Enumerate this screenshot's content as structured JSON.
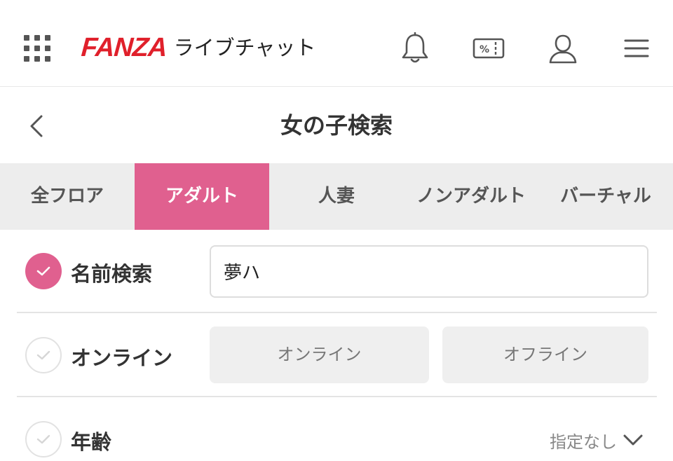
{
  "header": {
    "brand": "FANZA",
    "service": "ライブチャット",
    "icons": [
      "apps-grid-icon",
      "bell-icon",
      "coupon-icon",
      "user-icon",
      "hamburger-menu-icon"
    ],
    "coupon_symbol": "%"
  },
  "titlebar": {
    "title": "女の子検索"
  },
  "tabs": [
    {
      "label": "全フロア",
      "active": false
    },
    {
      "label": "アダルト",
      "active": true
    },
    {
      "label": "人妻",
      "active": false
    },
    {
      "label": "ノンアダルト",
      "active": false
    },
    {
      "label": "バーチャル",
      "active": false
    }
  ],
  "filters": {
    "name_search": {
      "label": "名前検索",
      "checked": true,
      "value": "夢ハ"
    },
    "online": {
      "label": "オンライン",
      "checked": false,
      "options": [
        "オンライン",
        "オフライン"
      ]
    },
    "age": {
      "label": "年齢",
      "checked": false,
      "value": "指定なし"
    }
  },
  "colors": {
    "accent_pink": "#e0608f",
    "brand_red": "#e0202b",
    "tab_bg": "#ededed"
  }
}
